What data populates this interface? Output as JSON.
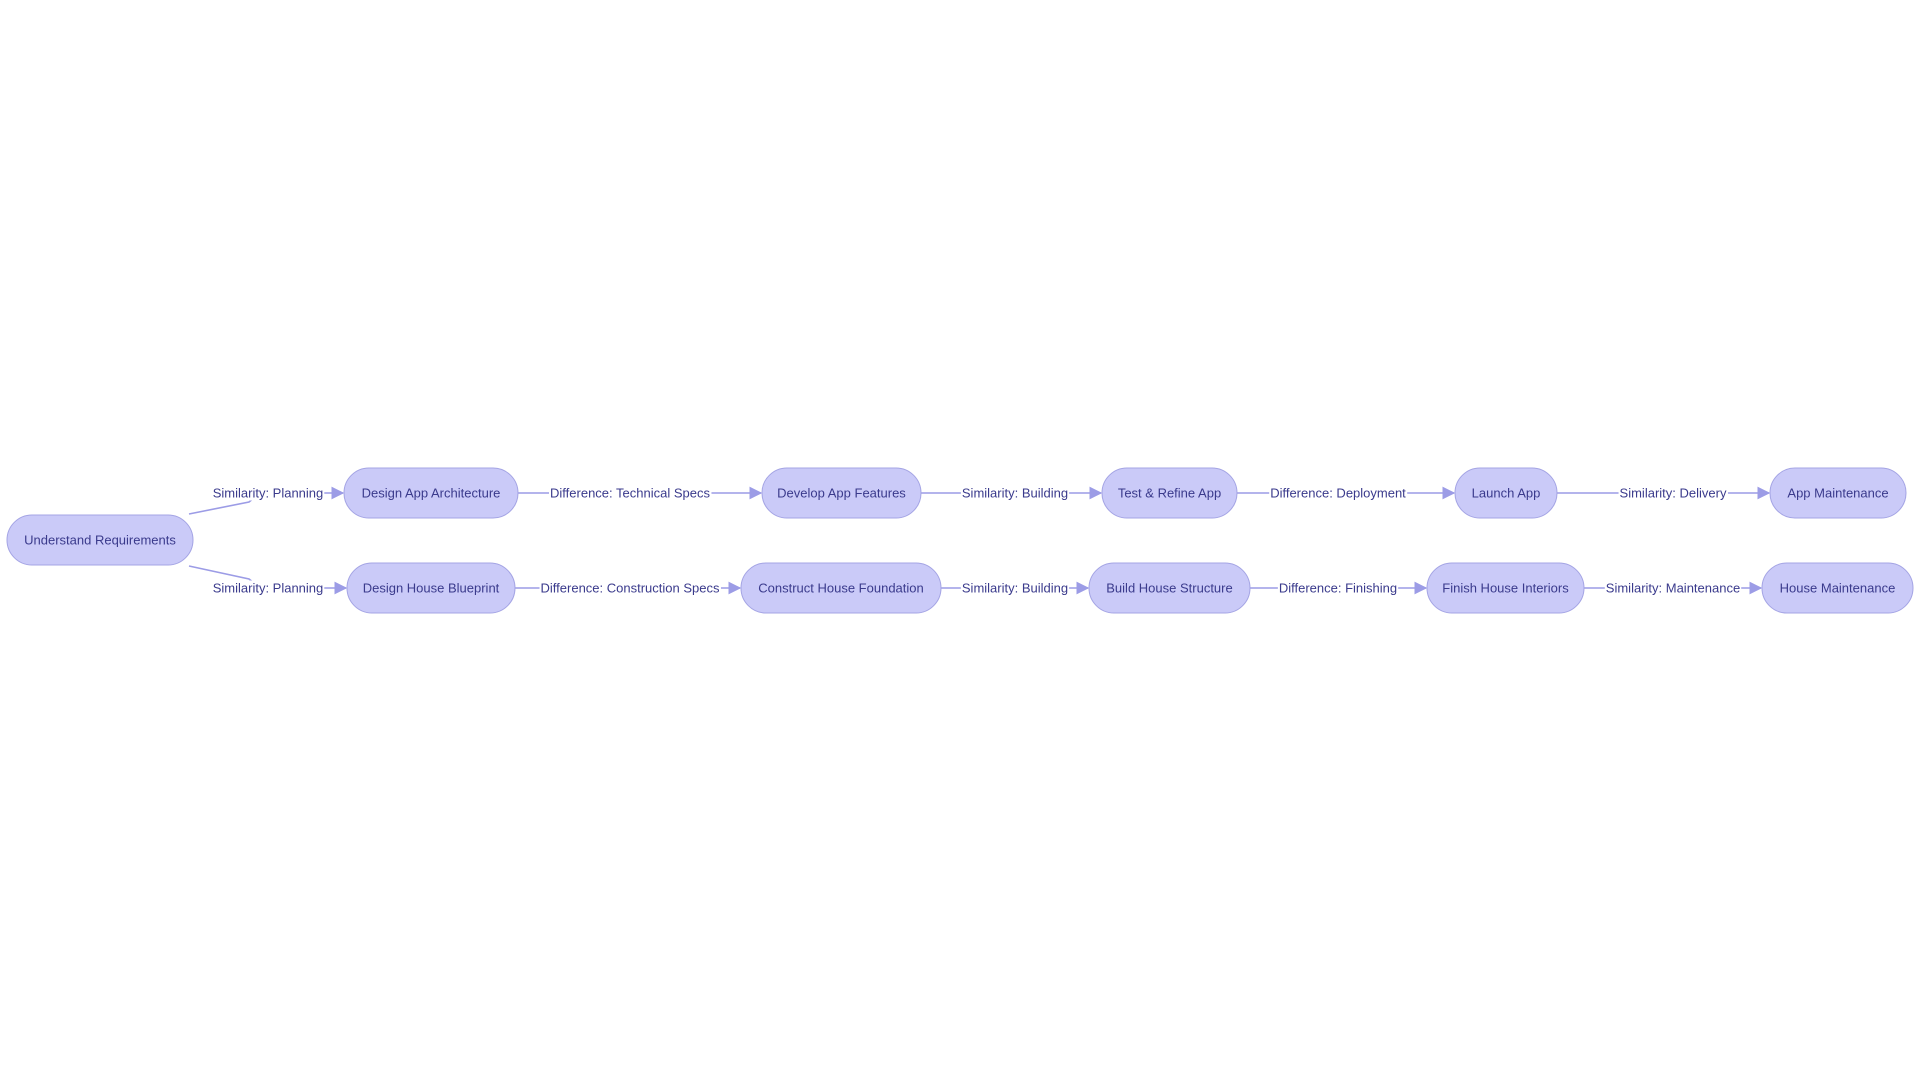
{
  "diagram": {
    "type": "flowchart",
    "direction": "left-to-right",
    "colors": {
      "node_fill": "#cacaf8",
      "node_stroke": "#a4a4e4",
      "text": "#3a3a8c",
      "edge": "#9c9ce6",
      "background": "#ffffff"
    },
    "nodes": [
      {
        "id": "A",
        "label": "Understand Requirements"
      },
      {
        "id": "B",
        "label": "Design App Architecture"
      },
      {
        "id": "C",
        "label": "Develop App Features"
      },
      {
        "id": "D",
        "label": "Test & Refine App"
      },
      {
        "id": "E",
        "label": "Launch App"
      },
      {
        "id": "F",
        "label": "App Maintenance"
      },
      {
        "id": "G",
        "label": "Design House Blueprint"
      },
      {
        "id": "H",
        "label": "Construct House Foundation"
      },
      {
        "id": "I",
        "label": "Build House Structure"
      },
      {
        "id": "J",
        "label": "Finish House Interiors"
      },
      {
        "id": "K",
        "label": "House Maintenance"
      }
    ],
    "edges": [
      {
        "from": "A",
        "to": "B",
        "label": "Similarity: Planning"
      },
      {
        "from": "B",
        "to": "C",
        "label": "Difference: Technical Specs"
      },
      {
        "from": "C",
        "to": "D",
        "label": "Similarity: Building"
      },
      {
        "from": "D",
        "to": "E",
        "label": "Difference: Deployment"
      },
      {
        "from": "E",
        "to": "F",
        "label": "Similarity: Delivery"
      },
      {
        "from": "A",
        "to": "G",
        "label": "Similarity: Planning"
      },
      {
        "from": "G",
        "to": "H",
        "label": "Difference: Construction Specs"
      },
      {
        "from": "H",
        "to": "I",
        "label": "Similarity: Building"
      },
      {
        "from": "I",
        "to": "J",
        "label": "Difference: Finishing"
      },
      {
        "from": "J",
        "to": "K",
        "label": "Similarity: Maintenance"
      }
    ]
  }
}
